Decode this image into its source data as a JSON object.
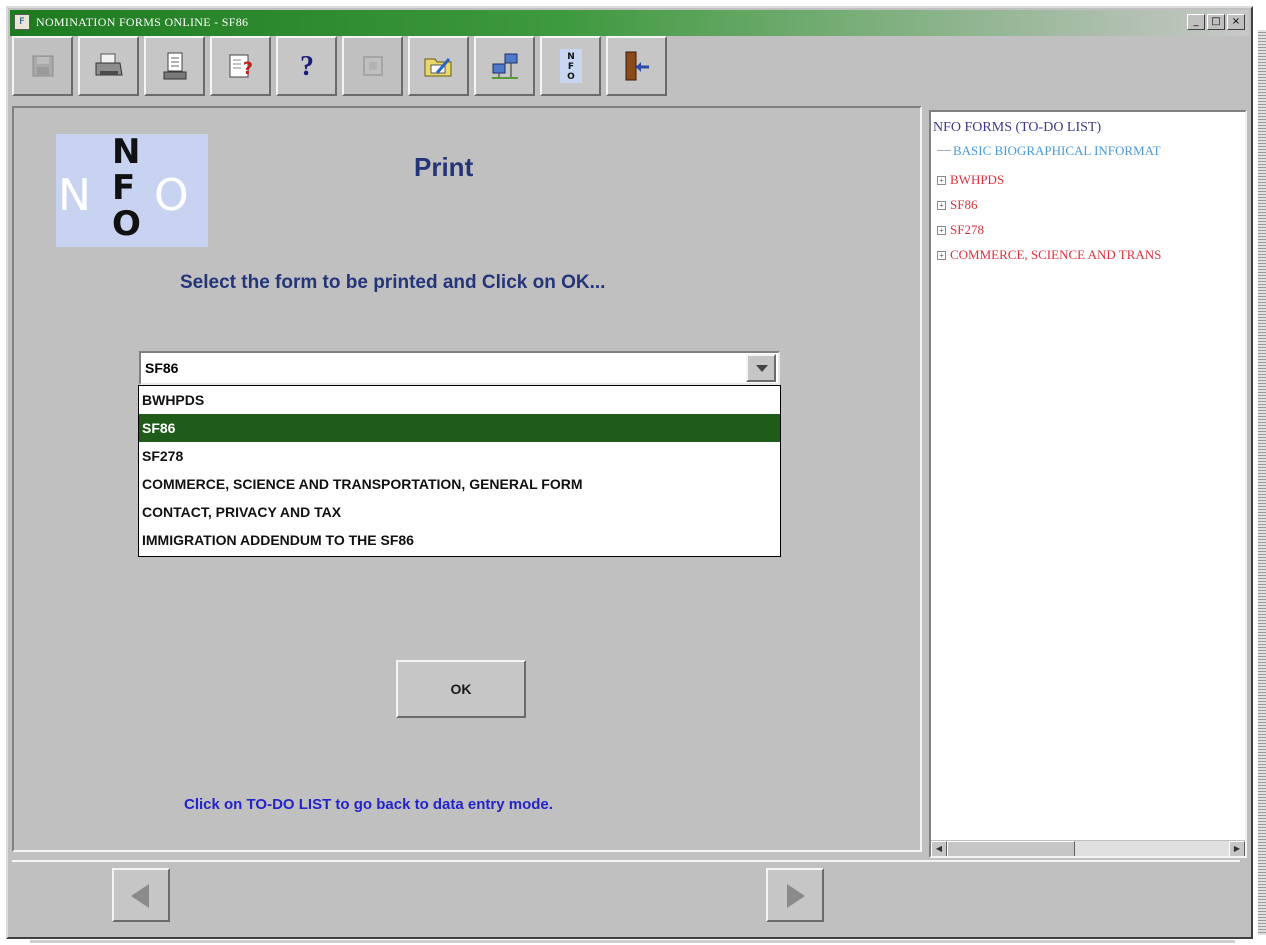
{
  "window": {
    "title": "NOMINATION FORMS ONLINE - SF86",
    "app_icon": "F",
    "controls": {
      "minimize": "_",
      "maximize": "□",
      "close": "×"
    }
  },
  "toolbar": {
    "buttons": [
      {
        "icon": "save-icon",
        "enabled": false
      },
      {
        "icon": "print-icon",
        "enabled": true
      },
      {
        "icon": "preview-icon",
        "enabled": true
      },
      {
        "icon": "validate-icon",
        "enabled": true
      },
      {
        "icon": "help-icon",
        "label": "?",
        "enabled": true
      },
      {
        "icon": "disabled-tool-icon",
        "enabled": false
      },
      {
        "icon": "folder-edit-icon",
        "enabled": true
      },
      {
        "icon": "network-icon",
        "enabled": true
      },
      {
        "icon": "nfo-icon",
        "enabled": true
      },
      {
        "icon": "exit-icon",
        "enabled": true
      }
    ]
  },
  "main": {
    "logo": {
      "vertical": [
        "N",
        "F",
        "O"
      ],
      "horizontal": [
        "N",
        "O"
      ]
    },
    "title": "Print",
    "instruction": "Select the form to be printed and Click on OK...",
    "combo": {
      "selected": "SF86",
      "options": [
        "BWHPDS",
        "SF86",
        "SF278",
        "COMMERCE, SCIENCE AND TRANSPORTATION, GENERAL FORM",
        "CONTACT, PRIVACY AND TAX",
        "IMMIGRATION ADDENDUM TO THE SF86"
      ],
      "selected_index": 1
    },
    "ok_label": "OK",
    "hint": "Click on TO-DO LIST to go back to data entry mode."
  },
  "tree": {
    "root": "NFO FORMS (TO-DO LIST)",
    "items": [
      {
        "label": "BASIC BIOGRAPHICAL INFORMAT",
        "expandable": false
      },
      {
        "label": "BWHPDS",
        "expandable": true
      },
      {
        "label": "SF86",
        "expandable": true
      },
      {
        "label": "SF278",
        "expandable": true
      },
      {
        "label": "COMMERCE, SCIENCE AND TRANS",
        "expandable": true
      }
    ],
    "expander_symbol": "+"
  },
  "colors": {
    "title_gradient_start": "#1e7a1e",
    "selection": "#1f5c1a",
    "heading_text": "#25357a",
    "hint_text": "#2323c8",
    "tree_red": "#e0303c",
    "tree_blue": "#4a9ad8"
  }
}
